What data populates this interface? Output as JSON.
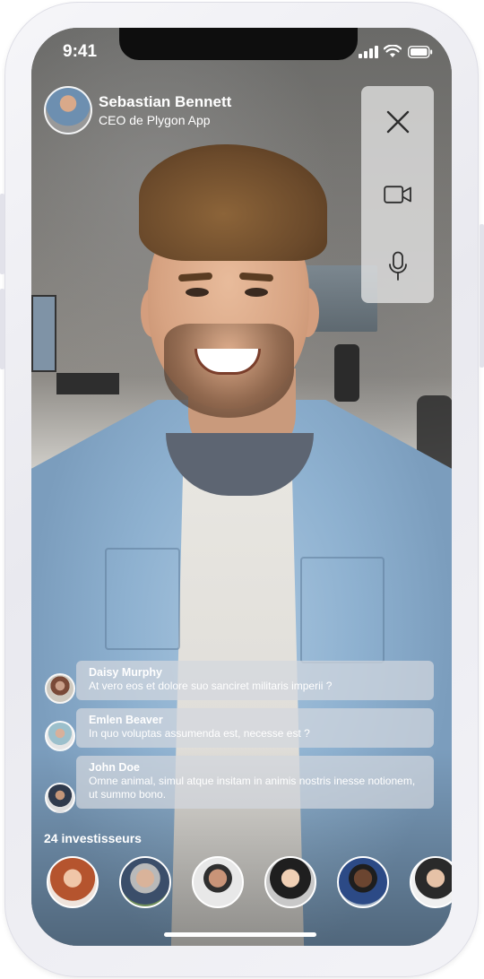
{
  "status_bar": {
    "time": "9:41"
  },
  "host": {
    "name": "Sebastian Bennett",
    "role": "CEO de Plygon App"
  },
  "controls": {
    "close_icon": "close-icon",
    "video_icon": "video-camera-icon",
    "mic_icon": "microphone-icon"
  },
  "comments": [
    {
      "name": "Daisy Murphy",
      "text": "At vero eos et dolore suo sanciret militaris imperii ?"
    },
    {
      "name": "Emlen Beaver",
      "text": "In quo voluptas assumenda est, necesse est ?"
    },
    {
      "name": "John Doe",
      "text": "Omne animal, simul atque insitam in animis nostris inesse notionem, ut summo bono."
    }
  ],
  "investors": {
    "label": "24 investisseurs"
  },
  "colors": {
    "text": "#ffffff",
    "panel": "#ebebeb",
    "bubble": "#d2d7de"
  }
}
